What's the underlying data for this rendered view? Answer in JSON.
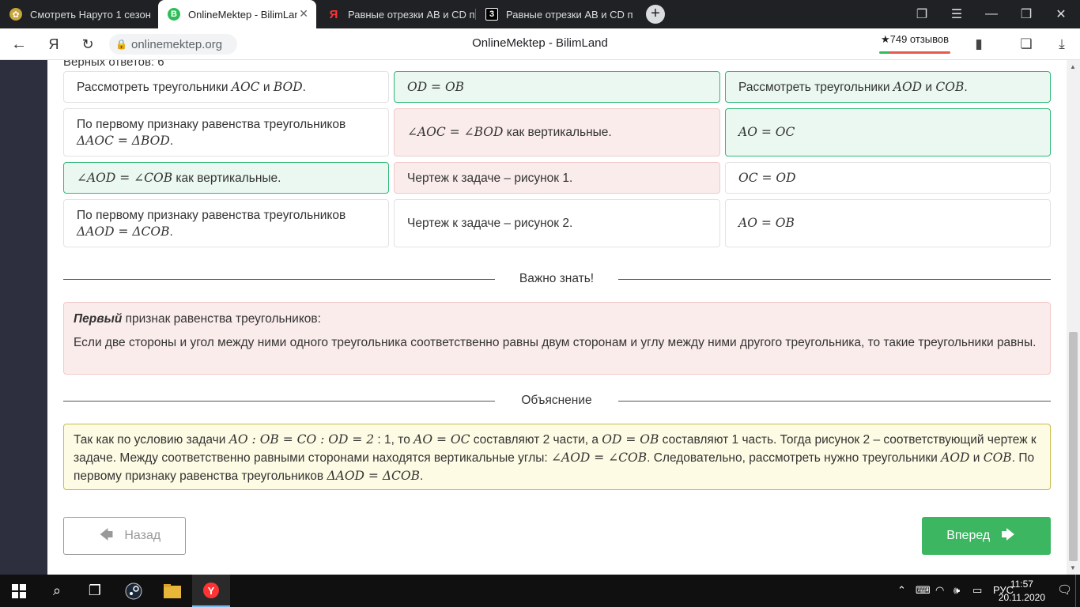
{
  "browser": {
    "tabs": [
      {
        "title": "Смотреть Наруто 1 сезон",
        "active": false
      },
      {
        "title": "OnlineMektep - BilimLand",
        "active": true
      },
      {
        "title": "Равные отрезки АВ и CD п",
        "active": false
      },
      {
        "title": "Равные отрезки АВ и CD п",
        "active": false
      }
    ],
    "url": "onlinemektep.org",
    "page_title": "OnlineMektep - BilimLand",
    "reviews": "★749 отзывов"
  },
  "content": {
    "correct_answers": "Верных ответов: 6",
    "grid": [
      {
        "text": "Рассмотреть треугольники ",
        "math1": "AOC",
        "mid": " и ",
        "math2": "BOD",
        "end": ".",
        "state": "neutral"
      },
      {
        "text": "",
        "math1": "OD = OB",
        "mid": "",
        "math2": "",
        "end": "",
        "state": "green"
      },
      {
        "text": "Рассмотреть треугольники ",
        "math1": "AOD",
        "mid": " и ",
        "math2": "COB",
        "end": ".",
        "state": "green"
      },
      {
        "text": "По первому признаку равенства треугольников",
        "math1": "ΔAOC = ΔBOD",
        "end": ".",
        "state": "neutral"
      },
      {
        "text": "",
        "math1": "∠AOC = ∠BOD",
        "mid": " как вертикальные.",
        "math2": "",
        "end": "",
        "state": "red"
      },
      {
        "text": "",
        "math1": "AO = OC",
        "mid": "",
        "math2": "",
        "end": "",
        "state": "green"
      },
      {
        "text": "",
        "math1": "∠AOD = ∠COB",
        "mid": " как вертикальные.",
        "math2": "",
        "end": "",
        "state": "green"
      },
      {
        "text": "Чертеж к задаче – рисунок 1.",
        "math1": "",
        "mid": "",
        "math2": "",
        "end": "",
        "state": "red"
      },
      {
        "text": "",
        "math1": "OC = OD",
        "mid": "",
        "math2": "",
        "end": "",
        "state": "neutral"
      },
      {
        "text": "По первому признаку равенства треугольников",
        "math1": "ΔAOD = ΔCOB",
        "end": ".",
        "state": "neutral"
      },
      {
        "text": "Чертеж к задаче – рисунок 2.",
        "math1": "",
        "mid": "",
        "math2": "",
        "end": "",
        "state": "neutral"
      },
      {
        "text": "",
        "math1": "AO = OB",
        "mid": "",
        "math2": "",
        "end": "",
        "state": "neutral"
      }
    ],
    "important_label": "Важно знать!",
    "important": {
      "bold": "Первый",
      "title_rest": " признак равенства треугольников:",
      "body": "Если две стороны и угол между ними одного треугольника соответственно равны двум сторонам и углу между ними другого треугольника, то такие треугольники равны."
    },
    "explanation_label": "Объяснение",
    "explanation": {
      "p1": "Так как по условию задачи ",
      "m1": "AO : OB = CO : OD = 2",
      "p2": " : 1, то ",
      "m2": "AO = OC",
      "p3": " составляют 2 части, а ",
      "m3": "OD = OB",
      "p4": " составляют 1 часть. Тогда рисунок 2 – соответствующий чертеж к задаче. Между соответственно равными сторонами находятся вертикальные углы: ",
      "m4": "∠AOD = ∠COB",
      "p5": ". Следовательно, рассмотреть нужно треугольники ",
      "m5": "AOD",
      "p6": " и ",
      "m6": "COB",
      "p7": ". По первому признаку равенства треугольников ",
      "m7": "ΔAOD = ΔCOB",
      "p8": "."
    },
    "back_label": "Назад",
    "next_label": "Вперед"
  },
  "taskbar": {
    "lang": "РУС",
    "time": "11:57",
    "date": "20.11.2020"
  },
  "colors": {
    "green_border": "#30b877",
    "green_bg": "#eaf8f1",
    "red_bg": "#fbecec",
    "next_button": "#3cb660"
  }
}
